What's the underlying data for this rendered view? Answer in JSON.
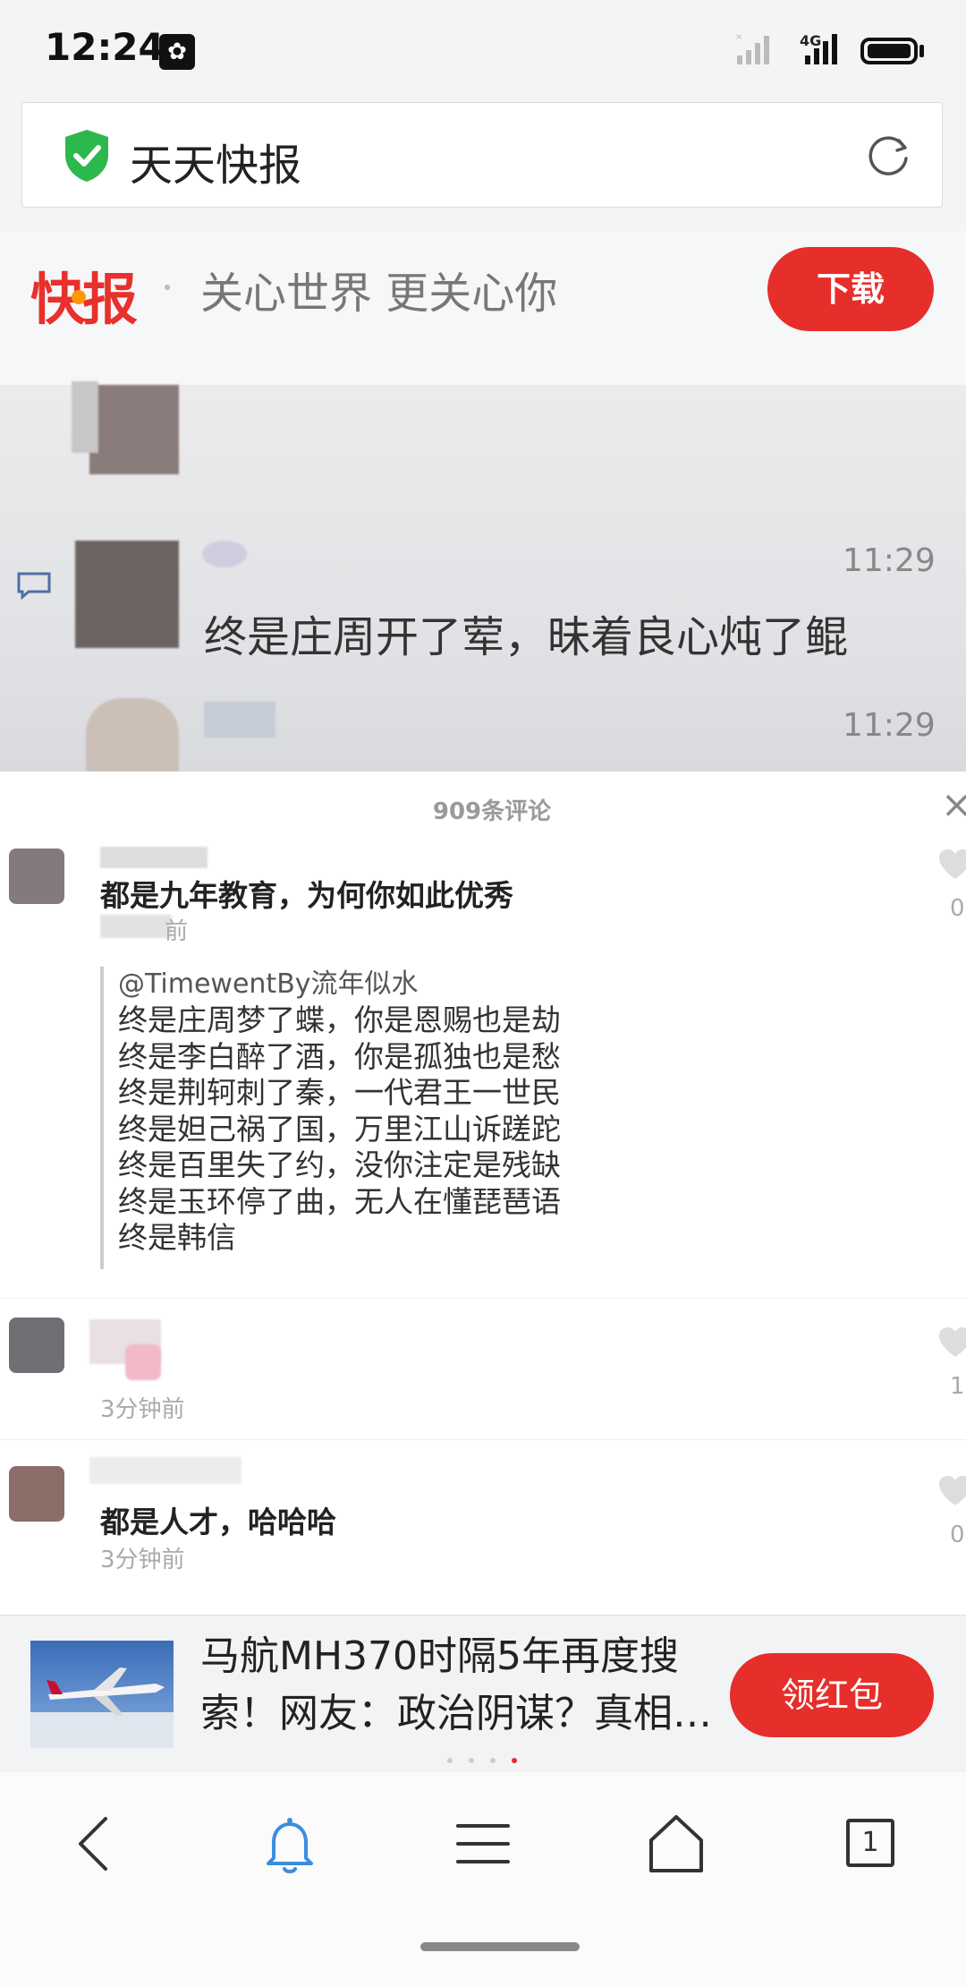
{
  "status_bar": {
    "time": "12:24",
    "network": "4G"
  },
  "address_bar": {
    "title": "天天快报"
  },
  "banner": {
    "logo_text": "快报",
    "slogan": "关心世界 更关心你",
    "download_label": "下载"
  },
  "chat": {
    "time1": "11:29",
    "message1": "终是庄周开了荤，昧着良心炖了鲲",
    "time2": "11:29"
  },
  "comments": {
    "title": "909条评论",
    "items": [
      {
        "text": "都是九年教育，为何你如此优秀",
        "time": "前",
        "likes": "0",
        "quote": {
          "author": "@TimewentBy流年似水",
          "lines": [
            "终是庄周梦了蝶，你是恩赐也是劫",
            "终是李白醉了酒，你是孤独也是愁",
            "终是荆轲刺了秦，一代君王一世民",
            "终是妲己祸了国，万里江山诉蹉跎",
            "终是百里失了约，没你注定是残缺",
            "终是玉环停了曲，无人在懂琵琶语",
            "终是韩信"
          ]
        }
      },
      {
        "text": "",
        "time": "3分钟前",
        "likes": "1"
      },
      {
        "text": "都是人才，哈哈哈",
        "time": "3分钟前",
        "likes": "0"
      }
    ]
  },
  "news": {
    "title_line1": "马航MH370时隔5年再度搜",
    "title_line2": "索！网友：政治阴谋？真相…",
    "button_label": "领红包"
  },
  "bottom_nav": {
    "tabs_count": "1"
  },
  "colors": {
    "accent_red": "#e62e2b",
    "link_blue": "#3b8de0",
    "shield_green": "#2db84d"
  }
}
